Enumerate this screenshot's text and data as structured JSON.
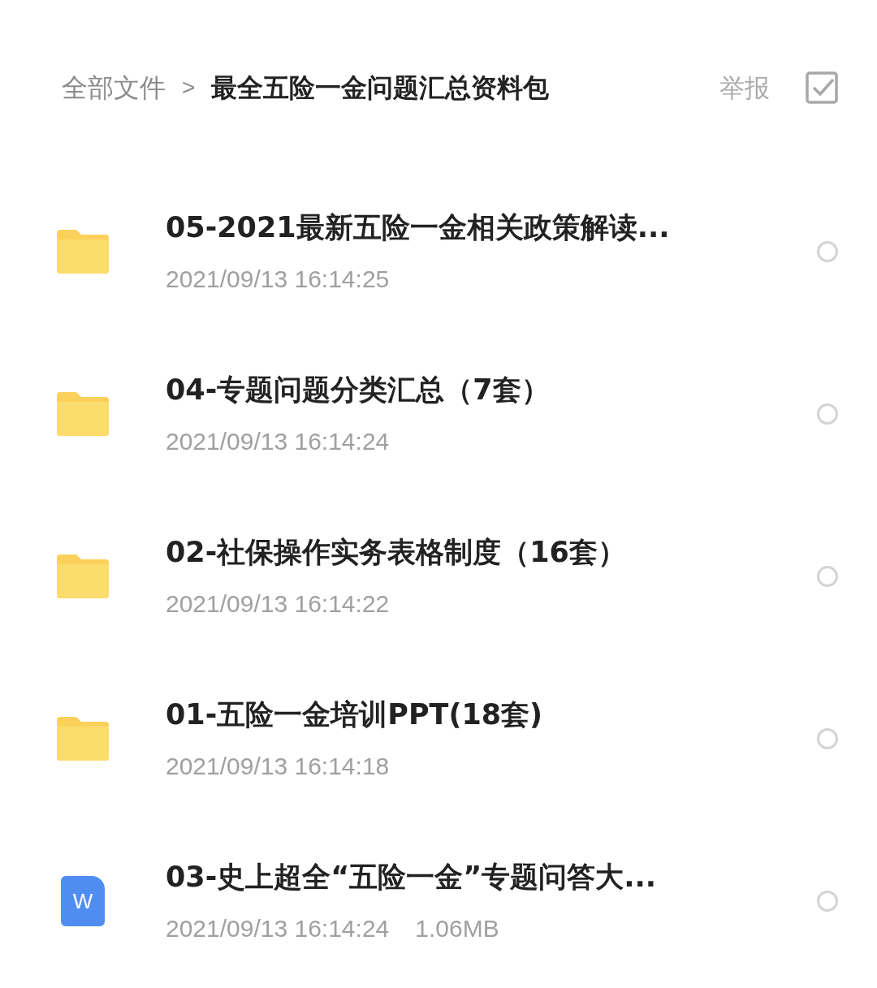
{
  "breadcrumb": {
    "root": "全部文件",
    "separator": ">",
    "current": "最全五险一金问题汇总资料包"
  },
  "actions": {
    "report": "举报"
  },
  "files": [
    {
      "kind": "folder",
      "name": "05-2021最新五险一金相关政策解读...",
      "time": "2021/09/13 16:14:25",
      "selected": false
    },
    {
      "kind": "folder",
      "name": "04-专题问题分类汇总（7套）",
      "time": "2021/09/13 16:14:24",
      "selected": false
    },
    {
      "kind": "folder",
      "name": "02-社保操作实务表格制度（16套）",
      "time": "2021/09/13 16:14:22",
      "selected": false
    },
    {
      "kind": "folder",
      "name": "01-五险一金培训PPT(18套)",
      "time": "2021/09/13 16:14:18",
      "selected": false
    },
    {
      "kind": "word",
      "icon_letter": "W",
      "name": "03-史上超全“五险一金”专题问答大...",
      "time": "2021/09/13 16:14:24",
      "size": "1.06MB",
      "selected": false
    }
  ]
}
